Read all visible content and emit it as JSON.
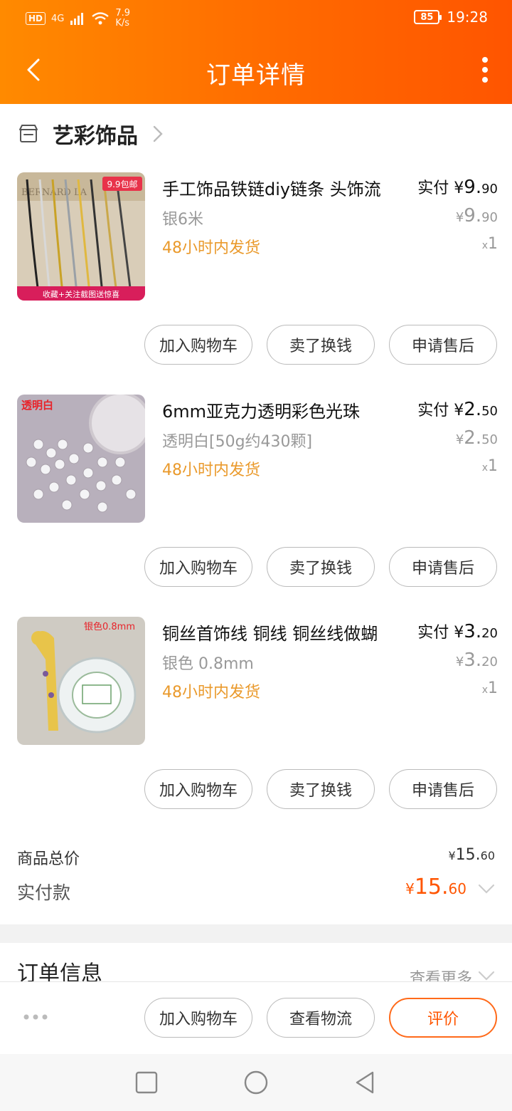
{
  "status_bar": {
    "hd": "HD",
    "network": "4G",
    "speed_value": "7.9",
    "speed_unit": "K/s",
    "battery": "85",
    "time": "19:28"
  },
  "header": {
    "title": "订单详情"
  },
  "store": {
    "name": "艺彩饰品"
  },
  "items": [
    {
      "name": "手工饰品铁链diy链条 头饰流",
      "spec": "银6米",
      "shipping": "48小时内发货",
      "paid_label": "实付",
      "currency": "¥",
      "paid_int": "9.",
      "paid_dec": "90",
      "orig_int": "9.",
      "orig_dec": "90",
      "qty_x": "x",
      "qty": "1",
      "thumb_text": "9.9包邮",
      "thumb_banner": "收藏+关注截图送惊喜"
    },
    {
      "name": "6mm亚克力透明彩色光珠",
      "spec": "透明白[50g约430颗]",
      "shipping": "48小时内发货",
      "paid_label": "实付",
      "currency": "¥",
      "paid_int": "2.",
      "paid_dec": "50",
      "orig_int": "2.",
      "orig_dec": "50",
      "qty_x": "x",
      "qty": "1",
      "thumb_text": "透明白"
    },
    {
      "name": "铜丝首饰线 铜线 铜丝线做蝴",
      "spec": "银色  0.8mm",
      "shipping": "48小时内发货",
      "paid_label": "实付",
      "currency": "¥",
      "paid_int": "3.",
      "paid_dec": "20",
      "orig_int": "3.",
      "orig_dec": "20",
      "qty_x": "x",
      "qty": "1",
      "thumb_text": "银色0.8mm"
    }
  ],
  "item_buttons": {
    "add_cart": "加入购物车",
    "sell": "卖了换钱",
    "after_sale": "申请售后"
  },
  "totals": {
    "goods_label": "商品总价",
    "goods_currency": "¥",
    "goods_int": "15.",
    "goods_dec": "60",
    "paid_label": "实付款",
    "paid_currency": "¥",
    "paid_int": "15.",
    "paid_dec": "60"
  },
  "order_info": {
    "title": "订单信息",
    "see_more": "查看更多"
  },
  "action_bar": {
    "add_cart": "加入购物车",
    "logistics": "查看物流",
    "review": "评价"
  },
  "colors": {
    "accent": "#ff6a00",
    "shipping": "#ea9a2c",
    "price": "#ff5500"
  }
}
